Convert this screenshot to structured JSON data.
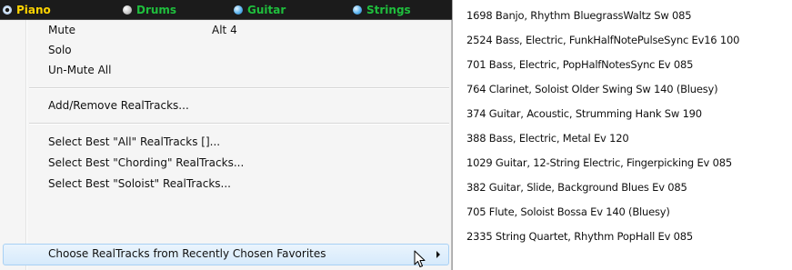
{
  "tracks": [
    {
      "label": "Piano",
      "state": "selected",
      "color": "#ffd400"
    },
    {
      "label": "Drums",
      "state": "plain",
      "color": "#1fbf3d"
    },
    {
      "label": "Guitar",
      "state": "blue",
      "color": "#1fbf3d"
    },
    {
      "label": "Strings",
      "state": "blue",
      "color": "#1fbf3d"
    }
  ],
  "menu": {
    "mute_label": "Mute",
    "mute_shortcut": "Alt 4",
    "solo_label": "Solo",
    "unmute_all_label": "Un-Mute All",
    "add_remove_label": "Add/Remove RealTracks...",
    "best_all_label": "Select Best \"All\" RealTracks []...",
    "best_chording_label": "Select Best \"Chording\" RealTracks...",
    "best_soloist_label": "Select Best \"Soloist\" RealTracks...",
    "favorites_label": "Choose RealTracks from Recently Chosen Favorites"
  },
  "favorites": [
    "1698 Banjo, Rhythm BluegrassWaltz Sw 085",
    "2524 Bass, Electric, FunkHalfNotePulseSync Ev16 100",
    "701 Bass, Electric, PopHalfNotesSync Ev 085",
    "764 Clarinet, Soloist Older Swing Sw 140 (Bluesy)",
    "374 Guitar, Acoustic, Strumming Hank Sw 190",
    "388 Bass, Electric, Metal Ev 120",
    "1029 Guitar, 12-String Electric, Fingerpicking Ev 085",
    "382 Guitar, Slide, Background Blues Ev 085",
    "705 Flute, Soloist Bossa Ev 140 (Bluesy)",
    "2335 String Quartet, Rhythm PopHall Ev 085"
  ],
  "colors": {
    "trackbar_bg": "#1b1b1b",
    "menu_bg": "#f5f5f5",
    "hover_bg": "#d6eafb",
    "hover_border": "#a8d0f4"
  }
}
